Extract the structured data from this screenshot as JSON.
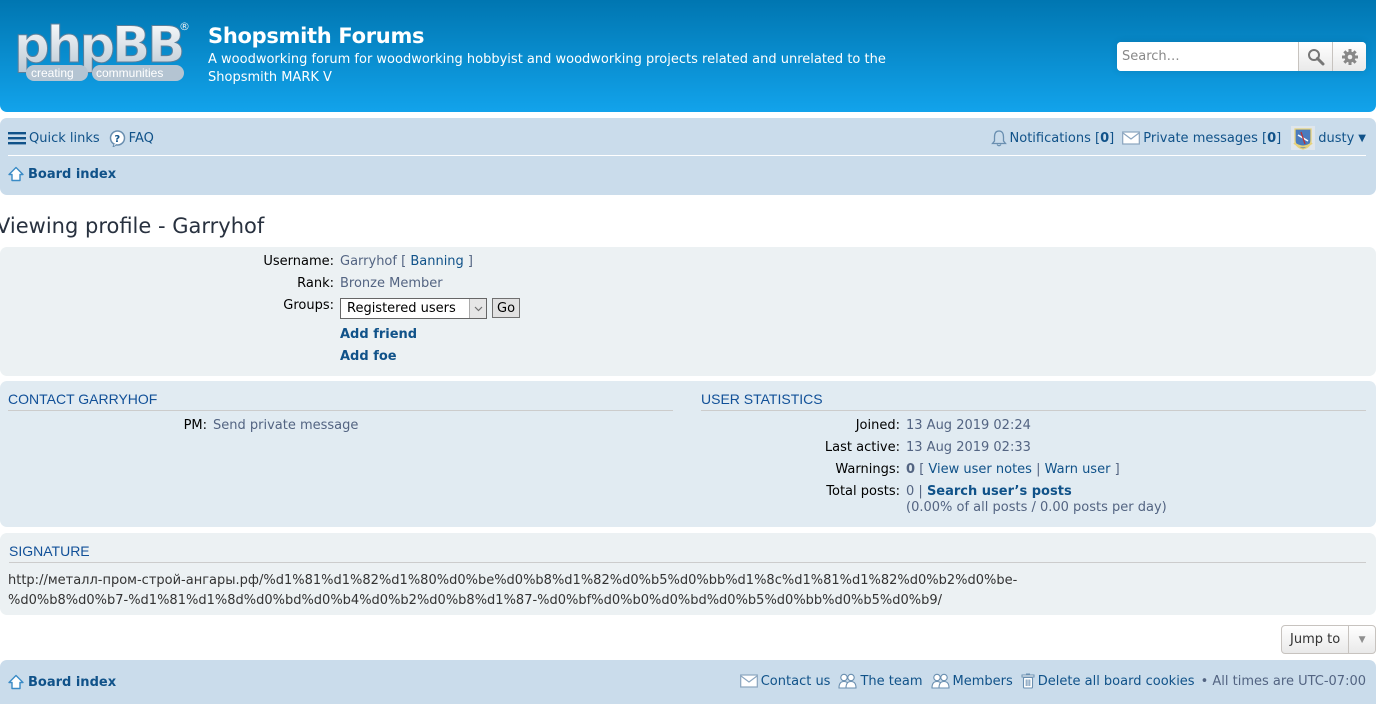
{
  "header": {
    "logo_main": "phpBB",
    "logo_tag_left": "creating",
    "logo_tag_right": "communities",
    "logo_registered": "®",
    "site_title": "Shopsmith Forums",
    "site_description": "A woodworking forum for woodworking hobbyist and woodworking projects related and unrelated to the Shopsmith MARK V",
    "search_placeholder": "Search…",
    "search_icon": "magnifier-icon",
    "advanced_search_icon": "gear-icon"
  },
  "navbar": {
    "quick_links": "Quick links",
    "faq": "FAQ",
    "notifications_label": "Notifications",
    "notifications_count": "0",
    "private_messages_label": "Private messages",
    "private_messages_count": "0",
    "username": "dusty",
    "breadcrumb": "Board index"
  },
  "page": {
    "title": "Viewing profile - Garryhof"
  },
  "profile": {
    "username_label": "Username:",
    "username": "Garryhof",
    "banning_link": "Banning",
    "rank_label": "Rank:",
    "rank": "Bronze Member",
    "groups_label": "Groups:",
    "groups_selected": "Registered users",
    "go_button": "Go",
    "add_friend": "Add friend",
    "add_foe": "Add foe"
  },
  "contact": {
    "heading": "CONTACT GARRYHOF",
    "pm_label": "PM:",
    "pm_link": "Send private message"
  },
  "stats": {
    "heading": "USER STATISTICS",
    "joined_label": "Joined:",
    "joined": "13 Aug 2019 02:24",
    "last_active_label": "Last active:",
    "last_active": "13 Aug 2019 02:33",
    "warnings_label": "Warnings:",
    "warnings": "0",
    "view_user_notes": "View user notes",
    "warn_user": "Warn user",
    "total_posts_label": "Total posts:",
    "total_posts": "0",
    "search_posts": "Search user’s posts",
    "posts_detail": "(0.00% of all posts / 0.00 posts per day)"
  },
  "signature": {
    "heading": "SIGNATURE",
    "line1": "http://металл-пром-строй-ангары.рф/%d1%81%d1%82%d1%80%d0%be%d0%b8%d1%82%d0%b5%d0%bb%d1%8c%d1%81%d1%82%d0%b2%d0%be-",
    "line2": "%d0%b8%d0%b7-%d1%81%d1%8d%d0%bd%d0%b4%d0%b2%d0%b8%d1%87-%d0%bf%d0%b0%d0%bd%d0%b5%d0%bb%d0%b5%d0%b9/"
  },
  "jump": {
    "label": "Jump to"
  },
  "footer": {
    "breadcrumb": "Board index",
    "contact_us": "Contact us",
    "the_team": "The team",
    "members": "Members",
    "delete_cookies": "Delete all board cookies",
    "timezone": "All times are UTC-07:00"
  },
  "colors": {
    "header_top": "#0076b1",
    "header_bottom": "#12a3eb",
    "navbar_bg": "#cadceb",
    "panel_bg": "#ecf1f3",
    "panel_bg2": "#e1ebf2",
    "link": "#105289"
  }
}
